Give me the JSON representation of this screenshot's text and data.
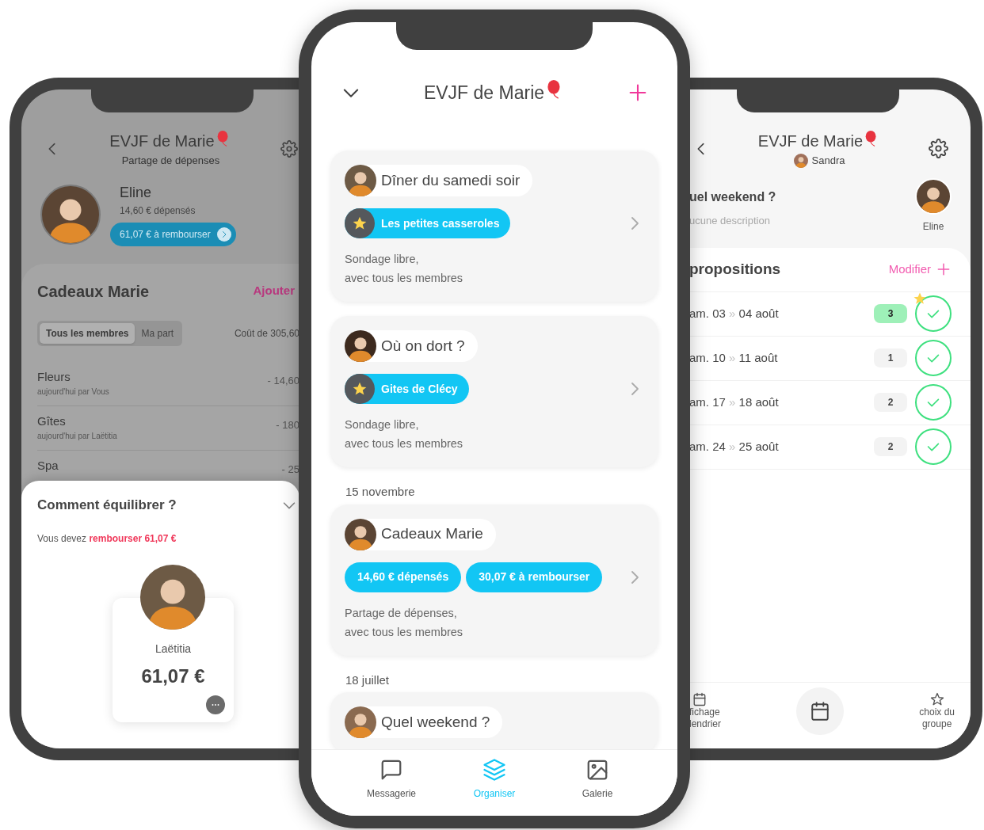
{
  "left_phone": {
    "header": {
      "title": "EVJF de Marie",
      "subtitle": "Partage de dépenses"
    },
    "profile": {
      "name": "Eline",
      "spent": "14,60 € dépensés",
      "balance_button": "61,07 € à rembourser"
    },
    "expense_group": {
      "title": "Cadeaux Marie",
      "add_link": "Ajouter",
      "tabs": [
        {
          "label": "Tous les membres",
          "selected": true
        },
        {
          "label": "Ma part",
          "selected": false
        }
      ],
      "total": "Coût de 305,60",
      "expenses": [
        {
          "name": "Fleurs",
          "detail": "aujourd'hui par Vous",
          "amount": "- 14,60"
        },
        {
          "name": "Gîtes",
          "detail": "aujourd'hui par Laëtitia",
          "amount": "- 180"
        },
        {
          "name": "Spa",
          "amount": "- 25"
        }
      ]
    },
    "balance_sheet": {
      "title": "Comment équilibrer ?",
      "text": "Vous devez",
      "highlight": "rembourser 61,07 €",
      "creditor": {
        "name": "Laëtitia",
        "amount": "61,07 €"
      }
    }
  },
  "center_phone": {
    "header": {
      "title": "EVJF de Marie"
    },
    "feed": [
      {
        "kind": "card",
        "title": "Dîner du samedi soir",
        "tags": [
          {
            "label": "Les petites casseroles",
            "starred": true
          }
        ],
        "description": "Sondage libre,\navec tous les membres"
      },
      {
        "kind": "card",
        "title": "Où on dort ?",
        "tags": [
          {
            "label": "Gites de Clécy",
            "starred": true
          }
        ],
        "description": "Sondage libre,\navec tous les membres"
      },
      {
        "kind": "date",
        "label": "15 novembre"
      },
      {
        "kind": "card",
        "title": "Cadeaux Marie",
        "tags": [
          {
            "label": "14,60 € dépensés",
            "starred": false
          },
          {
            "label": "30,07 € à rembourser",
            "starred": false
          }
        ],
        "description": "Partage de dépenses,\navec tous les membres"
      },
      {
        "kind": "date",
        "label": "18 juillet"
      },
      {
        "kind": "card",
        "title": "Quel weekend ?"
      }
    ],
    "tab_bar": [
      {
        "kind": "messages",
        "label": "Messagerie",
        "selected": false
      },
      {
        "kind": "organize",
        "label": "Organiser",
        "selected": true
      },
      {
        "kind": "gallery",
        "label": "Galerie",
        "selected": false
      }
    ]
  },
  "right_phone": {
    "header": {
      "title": "EVJF de Marie",
      "author": "Sandra"
    },
    "question": {
      "title": "uel weekend ?",
      "description": "ucune description",
      "member": "Eline"
    },
    "poll": {
      "title": "propositions",
      "edit_link": "Modifier",
      "options": [
        {
          "start": "am. 03",
          "separator": "»",
          "end": "04 août",
          "count": "3",
          "top": true,
          "starred": true
        },
        {
          "start": "am. 10",
          "separator": "»",
          "end": "11 août",
          "count": "1",
          "top": false,
          "starred": false
        },
        {
          "start": "am. 17",
          "separator": "»",
          "end": "18 août",
          "count": "2",
          "top": false,
          "starred": false
        },
        {
          "start": "am. 24",
          "separator": "»",
          "end": "25 août",
          "count": "2",
          "top": false,
          "starred": false
        }
      ]
    },
    "bottom_bar": [
      {
        "kind": "calendar-view",
        "label": "fichage\nlendrier"
      },
      {
        "kind": "calendar-button"
      },
      {
        "kind": "group-choice",
        "label": "choix du\ngroupe"
      }
    ]
  }
}
